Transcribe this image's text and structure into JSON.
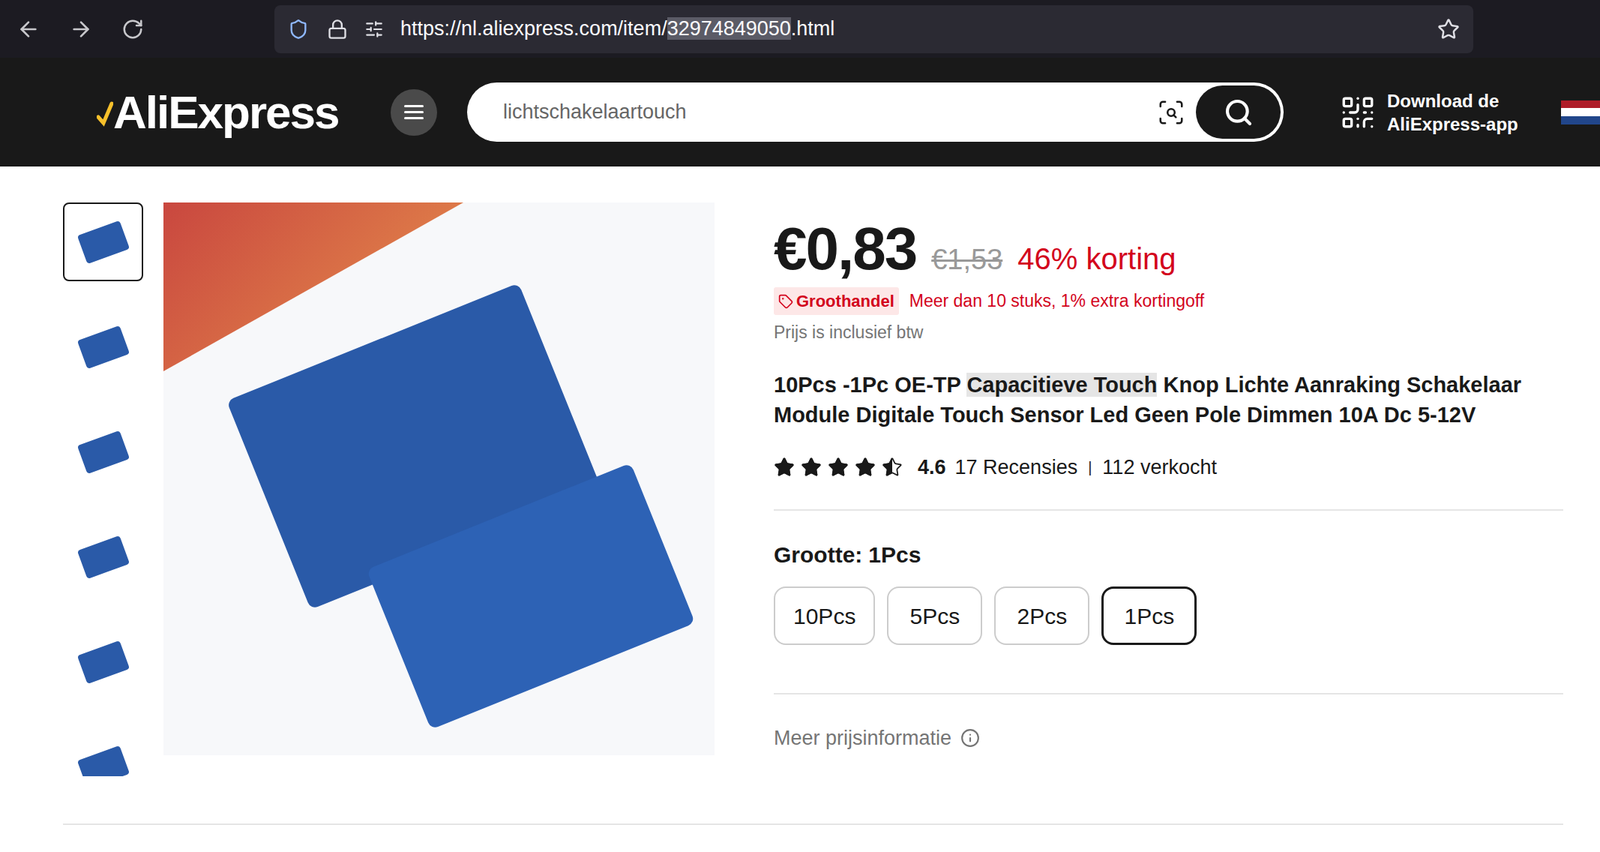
{
  "browser": {
    "url_prefix": "https://nl.aliexpress.com/item/",
    "url_selected": "32974849050",
    "url_suffix": ".html"
  },
  "header": {
    "logo": "AliExpress",
    "search": {
      "value": "lichtschakelaartouch"
    },
    "download": [
      "Download de",
      "AliExpress-app"
    ]
  },
  "gallery": {
    "thumbnails": [
      {
        "selected": true
      },
      {
        "selected": false
      },
      {
        "selected": false
      },
      {
        "selected": false
      },
      {
        "selected": false
      },
      {
        "selected": false
      }
    ]
  },
  "product": {
    "price": "€0,83",
    "original_price": "€1,53",
    "discount": "46% korting",
    "wholesale": {
      "badge": "Groothandel",
      "text": "Meer dan 10 stuks, 1% extra kortingoff"
    },
    "tax_note": "Prijs is inclusief btw",
    "title": [
      {
        "text": "10Pcs -1Pc OE-TP ",
        "highlighted": false
      },
      {
        "text": "Capacitieve Touch",
        "highlighted": true
      },
      {
        "text": " Knop Lichte Aanraking Schakelaar Module Digitale Touch Sensor Led Geen Pole Dimmen 10A Dc 5-12V",
        "highlighted": false
      }
    ],
    "rating": {
      "stars": 4.5,
      "score": "4.6",
      "reviews": "17 Recensies",
      "separator": "|",
      "sold": "112 verkocht"
    },
    "size": {
      "label": "Grootte:",
      "value": "1Pcs",
      "options": [
        {
          "label": "10Pcs",
          "selected": false
        },
        {
          "label": "5Pcs",
          "selected": false
        },
        {
          "label": "2Pcs",
          "selected": false
        },
        {
          "label": "1Pcs",
          "selected": true
        }
      ]
    },
    "more_price_info": "Meer prijsinformatie"
  }
}
